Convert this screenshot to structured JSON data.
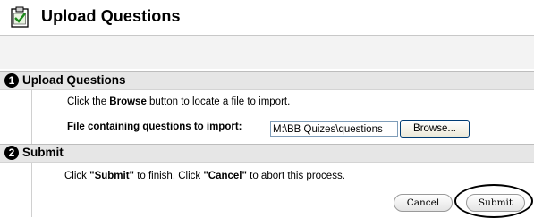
{
  "page": {
    "title": "Upload Questions"
  },
  "steps": [
    {
      "number": "1",
      "title": "Upload Questions",
      "instruction_prefix": "Click the ",
      "instruction_bold": "Browse",
      "instruction_suffix": " button to locate a file to import.",
      "file_label": "File containing questions to import:",
      "file_value": "M:\\BB Quizes\\questions",
      "browse_label": "Browse..."
    },
    {
      "number": "2",
      "title": "Submit",
      "text_1": "Click ",
      "text_2": "\"Submit\"",
      "text_3": " to finish. Click ",
      "text_4": "\"Cancel\"",
      "text_5": " to abort this process.",
      "cancel_label": "Cancel",
      "submit_label": "Submit"
    }
  ]
}
